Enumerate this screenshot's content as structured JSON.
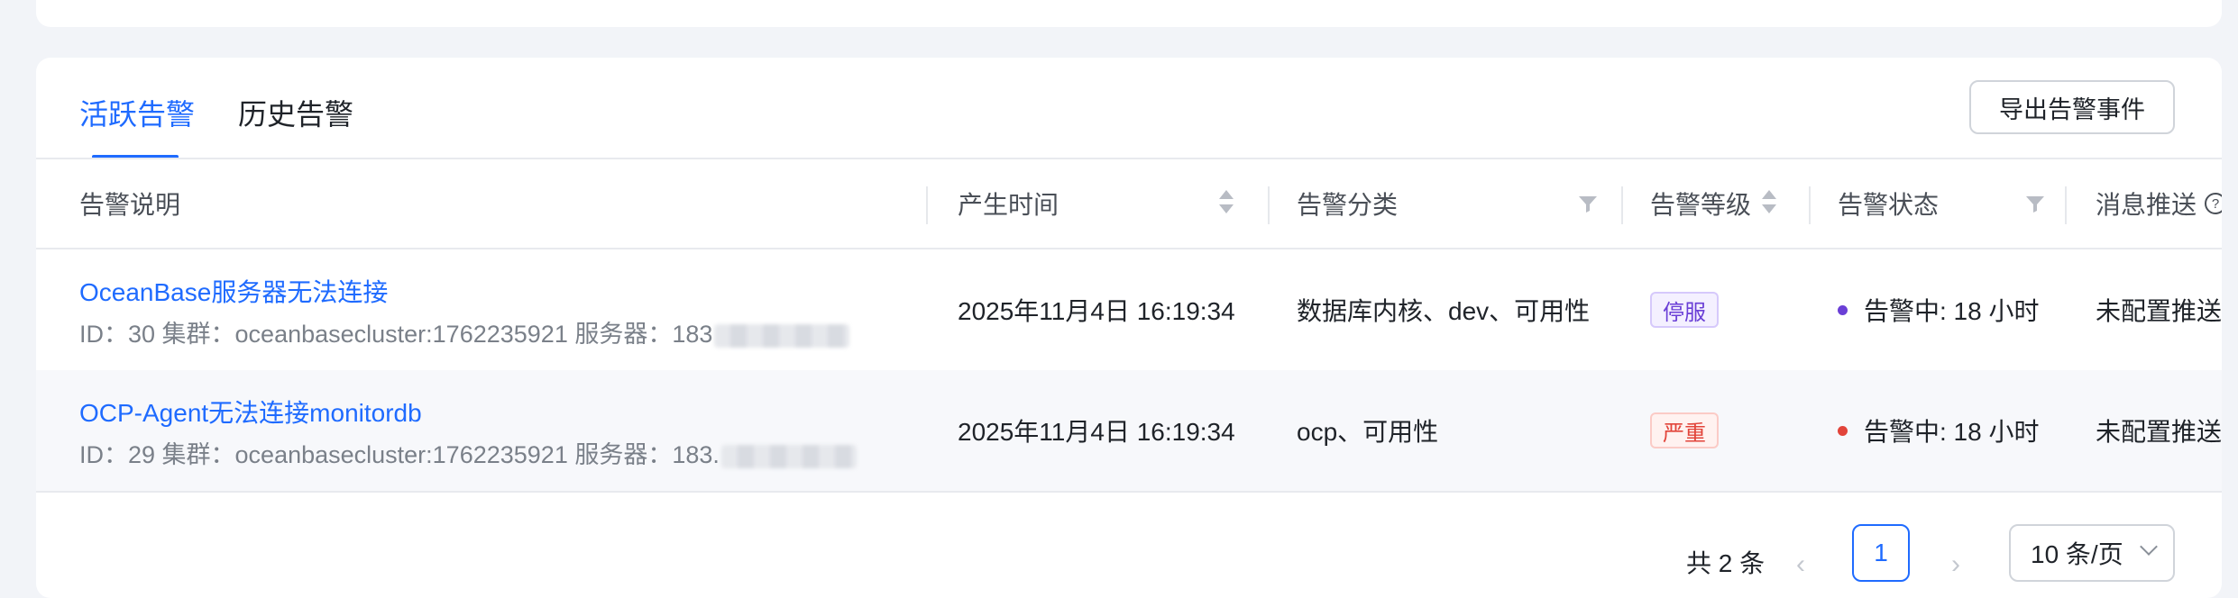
{
  "tabs": {
    "active": "活跃告警",
    "history": "历史告警"
  },
  "toolbar": {
    "export_label": "导出告警事件"
  },
  "table": {
    "columns": {
      "description": "告警说明",
      "time": "产生时间",
      "category": "告警分类",
      "level": "告警等级",
      "status": "告警状态",
      "push": "消息推送"
    },
    "rows": [
      {
        "title": "OceanBase服务器无法连接",
        "subtitle": "ID：30  集群：oceanbasecluster:1762235921  服务器：183",
        "time": "2025年11月4日 16:19:34",
        "category": "数据库内核、dev、可用性",
        "level": "停服",
        "status": "告警中: 18 小时",
        "push": "未配置推送",
        "status_color": "#6a3fd6"
      },
      {
        "title": "OCP-Agent无法连接monitordb",
        "subtitle": "ID：29  集群：oceanbasecluster:1762235921  服务器：183.",
        "time": "2025年11月4日 16:19:34",
        "category": "ocp、可用性",
        "level": "严重",
        "status": "告警中: 18 小时",
        "push": "未配置推送",
        "status_color": "#e2443a"
      }
    ]
  },
  "pagination": {
    "total": "共 2 条",
    "current_page": "1",
    "page_size": "10 条/页"
  },
  "colors": {
    "accent": "#1f6bff",
    "critical": "#e2443a",
    "outage": "#6a3fd6"
  },
  "icons": [
    "sort-icon",
    "filter-icon",
    "help-icon",
    "prev-icon",
    "next-icon",
    "chevron-down-icon"
  ]
}
